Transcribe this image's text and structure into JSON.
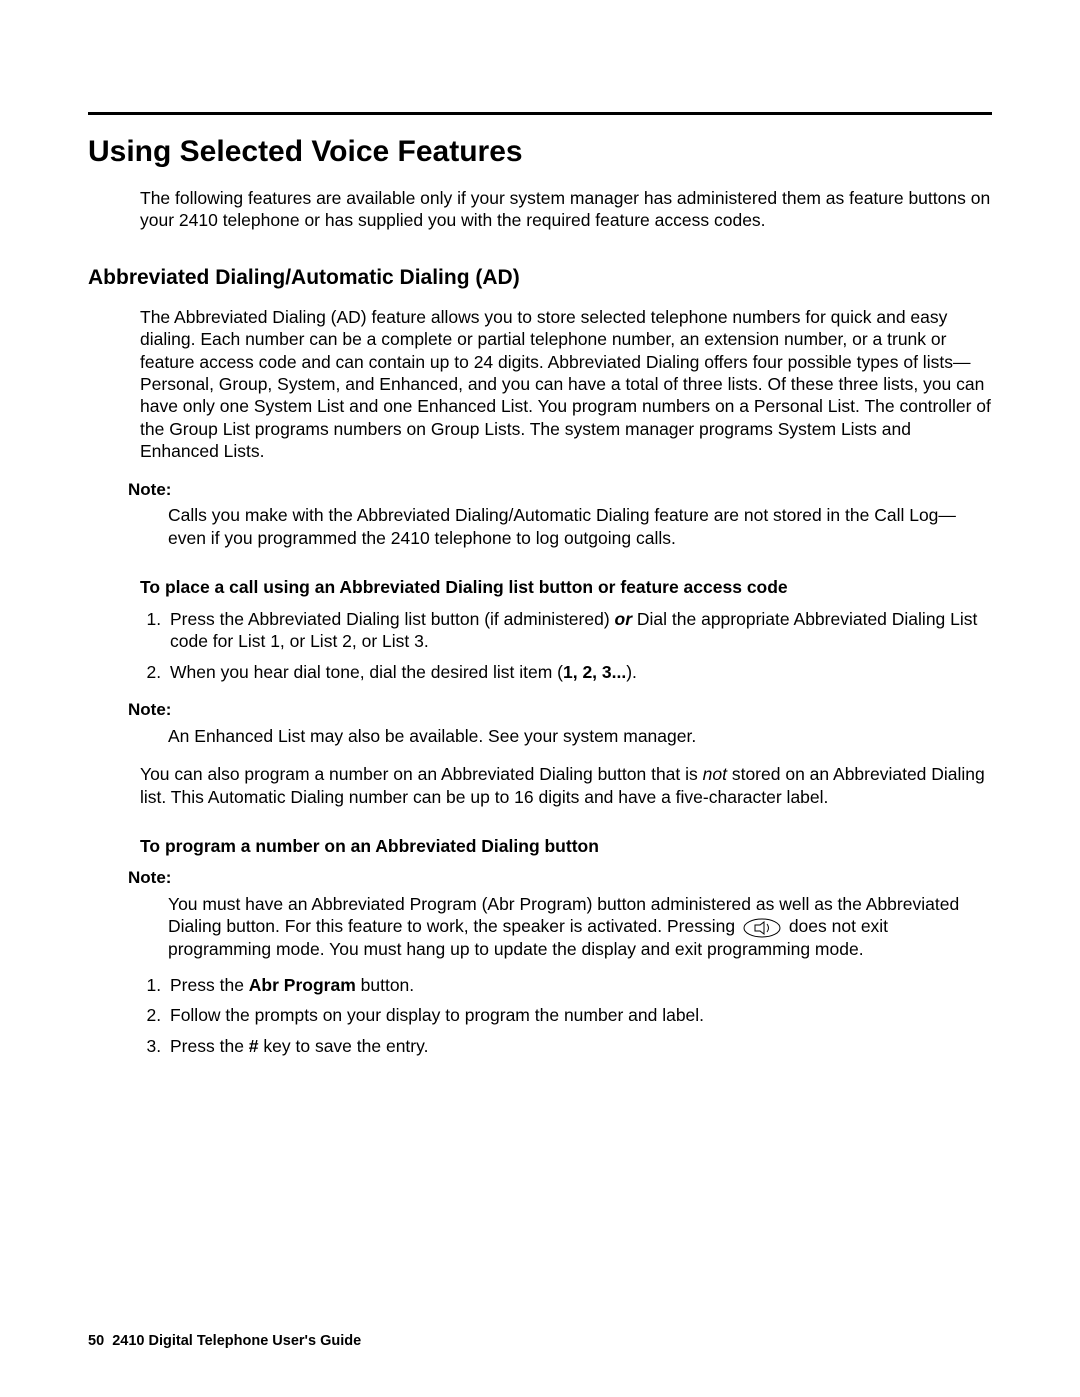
{
  "title": "Using Selected Voice Features",
  "intro": "The following features are available only if your system manager has administered them as feature buttons on your 2410 telephone or has supplied you with the required feature access codes.",
  "section1": {
    "heading": "Abbreviated Dialing/Automatic Dialing (AD)",
    "body": "The Abbreviated Dialing (AD) feature allows you to store selected telephone numbers for quick and easy dialing. Each number can be a complete or partial telephone number, an extension number, or a trunk or feature access code and can contain up to 24 digits. Abbreviated Dialing offers four possible types of lists—Personal, Group, System, and Enhanced, and you can have a total of three lists. Of these three lists, you can have only one System List and one Enhanced List. You program numbers on a Personal List. The controller of the Group List programs numbers on Group Lists. The system manager programs System Lists and Enhanced Lists.",
    "note1_label": "Note:",
    "note1_text": "Calls you make with the Abbreviated Dialing/Automatic Dialing feature are not stored in the Call Log—even if you programmed the 2410 telephone to log outgoing calls.",
    "sub1": "To place a call using an Abbreviated Dialing list button or feature access code",
    "step1_a": "Press the Abbreviated Dialing list button (if administered) ",
    "step1_or": "or",
    "step1_b": " Dial the appropriate Abbreviated Dialing List code for List 1, or List 2, or List 3.",
    "step2_a": "When you hear dial tone, dial the desired list item (",
    "step2_bold": "1, 2, 3...",
    "step2_b": ").",
    "note2_label": "Note:",
    "note2_text": "An Enhanced List may also be available. See your system manager.",
    "body2_a": "You can also program a number on an Abbreviated Dialing button that is ",
    "body2_not": "not",
    "body2_b": " stored on an Abbreviated Dialing list. This Automatic Dialing number can be up to 16 digits and have a five-character label.",
    "sub2": "To program a number on an Abbreviated Dialing button",
    "note3_label": "Note:",
    "note3_a": "You must have an Abbreviated Program (Abr Program) button administered as well as the Abbreviated Dialing button. For this feature to work, the speaker is activated. Pressing ",
    "note3_b": " does not exit programming mode. You must hang up to update the display and exit programming mode.",
    "pstep1_a": "Press the ",
    "pstep1_bold": "Abr Program",
    "pstep1_b": " button.",
    "pstep2": "Follow the prompts on your display to program the number and label.",
    "pstep3_a": "Press the ",
    "pstep3_bold": "#",
    "pstep3_b": " key to save the entry."
  },
  "footer": {
    "page": "50",
    "doc": "2410 Digital Telephone User's Guide"
  }
}
